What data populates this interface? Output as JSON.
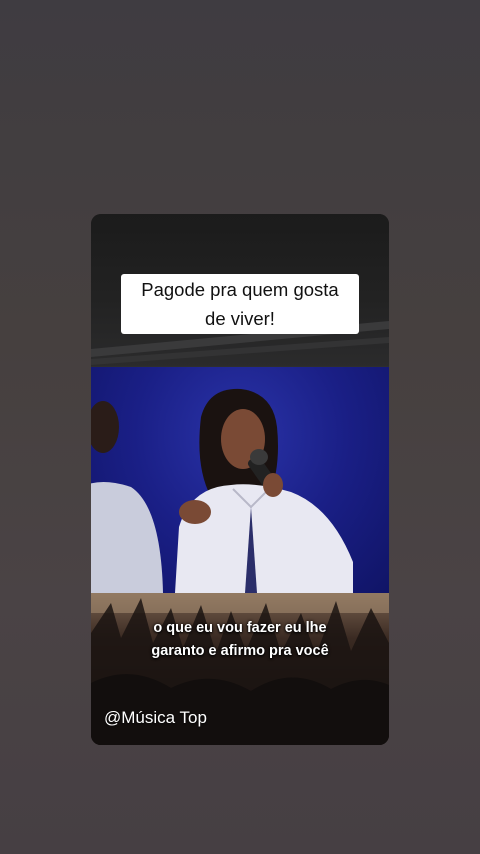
{
  "story": {
    "title_line1": "Pagode pra quem gosta",
    "title_line2": "de viver!",
    "subtitle_line1": "o que eu vou fazer eu lhe",
    "subtitle_line2": "garanto e afirmo pra você",
    "watermark": "@Música Top"
  },
  "colors": {
    "background": "#443f42",
    "video_background": "#1a1f86",
    "caption_box": "#ffffff"
  }
}
